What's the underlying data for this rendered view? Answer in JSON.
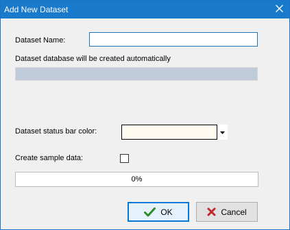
{
  "window": {
    "title": "Add New Dataset"
  },
  "form": {
    "name_label": "Dataset Name:",
    "name_value": "",
    "db_note": "Dataset database will be created automatically",
    "db_value": "",
    "color_label": "Dataset status bar color:",
    "color_value": "#fffbf0",
    "sample_label": "Create sample data:",
    "sample_checked": false
  },
  "progress": {
    "value": 0,
    "label": "0%"
  },
  "buttons": {
    "ok_label": "OK",
    "cancel_label": "Cancel"
  },
  "icons": {
    "close": "close-icon",
    "dropdown": "dropdown-arrow-icon",
    "ok": "check-icon",
    "cancel": "x-icon"
  },
  "colors": {
    "titlebar": "#1979ca",
    "ok_icon": "#2e8b2e",
    "cancel_icon": "#c0282a"
  }
}
